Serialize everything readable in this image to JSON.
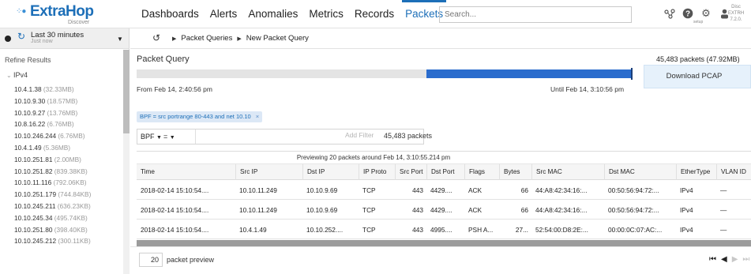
{
  "brand": {
    "name": "ExtraHop",
    "sub": "Discover",
    "user": "setup",
    "system": [
      "Disc",
      "EXTRH",
      "7.2.0."
    ]
  },
  "nav": {
    "items": [
      "Dashboards",
      "Alerts",
      "Anomalies",
      "Metrics",
      "Records",
      "Packets"
    ],
    "active": "Packets",
    "search_placeholder": "Search..."
  },
  "timeframe": {
    "label": "Last 30 minutes",
    "sub": "Just now"
  },
  "breadcrumbs": [
    "Packet Queries",
    "New Packet Query"
  ],
  "sidebar": {
    "title": "Refine Results",
    "group": "IPv4",
    "items": [
      {
        "ip": "10.4.1.38",
        "size": "(32.33MB)"
      },
      {
        "ip": "10.10.9.30",
        "size": "(18.57MB)"
      },
      {
        "ip": "10.10.9.27",
        "size": "(13.76MB)"
      },
      {
        "ip": "10.8.16.22",
        "size": "(6.76MB)"
      },
      {
        "ip": "10.10.246.244",
        "size": "(6.76MB)"
      },
      {
        "ip": "10.4.1.49",
        "size": "(5.36MB)"
      },
      {
        "ip": "10.10.251.81",
        "size": "(2.00MB)"
      },
      {
        "ip": "10.10.251.82",
        "size": "(839.38KB)"
      },
      {
        "ip": "10.10.11.116",
        "size": "(792.06KB)"
      },
      {
        "ip": "10.10.251.179",
        "size": "(744.84KB)"
      },
      {
        "ip": "10.10.245.211",
        "size": "(636.23KB)"
      },
      {
        "ip": "10.10.245.34",
        "size": "(495.74KB)"
      },
      {
        "ip": "10.10.251.80",
        "size": "(398.40KB)"
      },
      {
        "ip": "10.10.245.212",
        "size": "(300.11KB)"
      }
    ]
  },
  "query": {
    "title": "Packet Query",
    "summary": "45,483 packets (47.92MB)",
    "download": "Download PCAP",
    "from": "From Feb 14, 2:40:56 pm",
    "until": "Until Feb 14, 3:10:56 pm",
    "selection_start": 0.585,
    "selection_end": 1.0,
    "chip": "BPF = src portrange 80-443 and net 10.10",
    "chip_close": "×",
    "filter_field": "BPF",
    "filter_op": "=",
    "add_filter": "Add Filter",
    "filter_count": "45,483 packets"
  },
  "table": {
    "preview": "Previewing 20 packets around Feb 14, 3:10:55.214 pm",
    "columns": [
      "Time",
      "Src IP",
      "Dst IP",
      "IP Proto",
      "Src Port",
      "Dst Port",
      "Flags",
      "Bytes",
      "Src MAC",
      "Dst MAC",
      "EtherType",
      "VLAN ID"
    ],
    "rows": [
      [
        "2018-02-14 15:10:54....",
        "10.10.11.249",
        "10.10.9.69",
        "TCP",
        "443",
        "4429....",
        "ACK",
        "66",
        "44:A8:42:34:16:...",
        "00:50:56:94:72:...",
        "IPv4",
        "—"
      ],
      [
        "2018-02-14 15:10:54....",
        "10.10.11.249",
        "10.10.9.69",
        "TCP",
        "443",
        "4429....",
        "ACK",
        "66",
        "44:A8:42:34:16:...",
        "00:50:56:94:72:...",
        "IPv4",
        "—"
      ],
      [
        "2018-02-14 15:10:54....",
        "10.4.1.49",
        "10.10.252....",
        "TCP",
        "443",
        "4995....",
        "PSH A...",
        "27...",
        "52:54:00:D8:2E:...",
        "00:00:0C:07:AC:...",
        "IPv4",
        "—"
      ]
    ]
  },
  "footer": {
    "preview_count": "20",
    "preview_label": "packet preview"
  }
}
